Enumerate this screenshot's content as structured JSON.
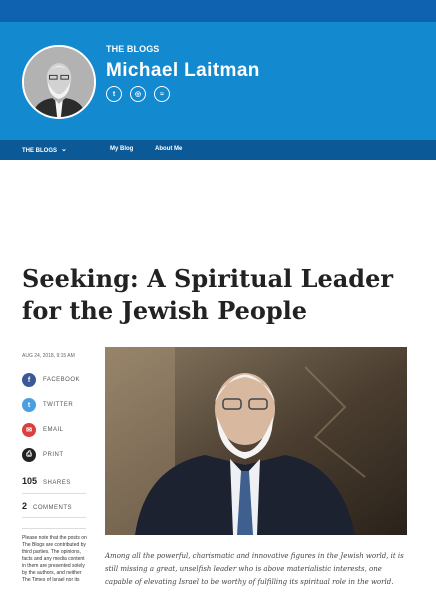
{
  "header": {
    "kicker": "THE BLOGS",
    "author": "Michael Laitman",
    "social_icons": [
      "twitter-icon",
      "website-icon",
      "rss-icon"
    ]
  },
  "nav": {
    "dropdown_label": "THE BLOGS",
    "links": [
      "My Blog",
      "About Me"
    ]
  },
  "article": {
    "title": "Seeking: A Spiritual Leader for the Jewish People",
    "date": "AUG 24, 2018, 9:15 AM",
    "share": {
      "facebook": "FACEBOOK",
      "twitter": "TWITTER",
      "email": "EMAIL",
      "print": "PRINT"
    },
    "shares_count": "105",
    "shares_label": "SHARES",
    "comments_count": "2",
    "comments_label": "COMMENTS",
    "disclaimer": "Please note that the posts on The Blogs are contributed by third parties. The opinions, facts and any media content in them are presented solely by the authors, and neither The Times of Israel nor its",
    "caption": "Among all the powerful, charismatic and innovative figures in the Jewish world, it is still missing a great, unselfish leader who is above materialistic interests, one capable of elevating Israel to be worthy of fulfilling its spiritual role in the world."
  },
  "colors": {
    "top_strip": "#0f62b0",
    "hero": "#1389cf",
    "nav": "#0b5a97",
    "facebook": "#3b5998",
    "twitter": "#4a9fe0",
    "email": "#d9403f"
  }
}
